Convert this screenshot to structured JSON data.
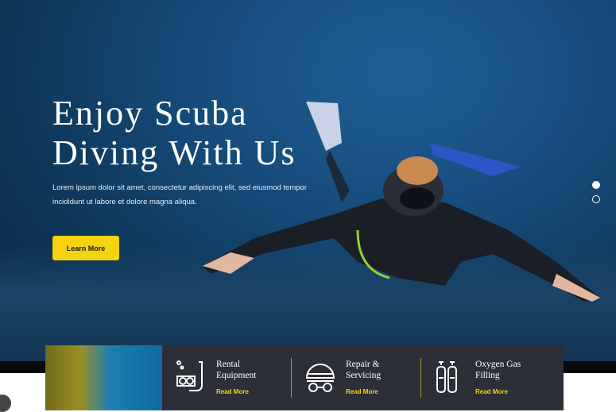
{
  "hero": {
    "title_line1": "Enjoy Scuba",
    "title_line2": "Diving With Us",
    "description": "Lorem ipsum dolor sit amet, consectetur adipiscing elit, sed eiusmod tempor incididunt ut labore et dolore magna aliqua.",
    "button_label": "Learn More",
    "slide_count": 2,
    "active_slide": 1
  },
  "services": [
    {
      "icon": "snorkel-mask-icon",
      "name_line1": "Rental",
      "name_line2": "Equipment",
      "link": "Read More"
    },
    {
      "icon": "diving-helmet-goggles-icon",
      "name_line1": "Repair &",
      "name_line2": "Servicing",
      "link": "Read More"
    },
    {
      "icon": "oxygen-tanks-icon",
      "name_line1": "Oxygen Gas",
      "name_line2": "Filling",
      "link": "Read More"
    }
  ],
  "colors": {
    "accent": "#f5d40f",
    "panel": "#2c2e38",
    "hero": "#164c7c"
  }
}
